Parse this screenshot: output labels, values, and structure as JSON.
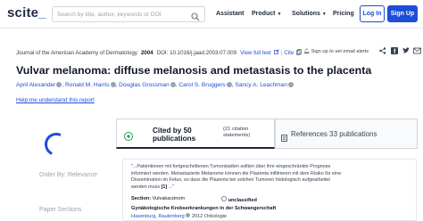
{
  "nav": {
    "logo_text": "scite",
    "logo_suffix": "_",
    "search_placeholder": "Search by title, author, keywords or DOI",
    "links": [
      "Assistant",
      "Product",
      "Solutions",
      "Pricing"
    ],
    "login": "Log In",
    "signup": "Sign Up"
  },
  "article": {
    "journal": "Journal of the American Academy of Dermatology",
    "year": "2004",
    "doi": "DOI: 10.1016/j.jaad.2003.07.009",
    "full_text": "View full text",
    "cite": "Cite",
    "alert": "Sign up to set email alerts",
    "title": "Vulvar melanoma: diffuse melanosis and metastasis to the placenta",
    "authors": [
      "April Alexander",
      "Ronald M. Harris",
      "Douglas Grossman",
      "Carol S. Bruggers",
      "Sancy A. Leachman"
    ],
    "help": "Help me understand this report"
  },
  "left_panel": {
    "order_by": "Order By: Relevance",
    "paper_sections": "Paper Sections"
  },
  "tabs": {
    "cited_by": "Cited by 50 publications",
    "citation_statements": "(21 citation statements)",
    "references": "References 33 publications"
  },
  "citation": {
    "snippet": "\"...Patientinnen mit fortgeschrittenen Tumorstadien sollten über ihre eingeschränkte Prognose informiert werden. Metastasierte Melanome können die Plazenta infiltrieren mit dem Risiko für eine Dissemination im Fetus, so dass die Plazenta bei solchen Tumoren histologisch aufgearbeitet werden muss",
    "ref_marker": "[1]",
    "trailing": "...\"",
    "section_label": "Section:",
    "section_value": "Vulvakarzinom",
    "classification": "unclassified",
    "paper_title": "Gynäkologische Krebserkrankungen in der Schwangerschaft",
    "author_1": "Hasenburg",
    "author_2": "Rautenberg",
    "year_source": "2012 Onkologie"
  },
  "colors": {
    "brand": "#1d4ed8",
    "text": "#111827"
  }
}
